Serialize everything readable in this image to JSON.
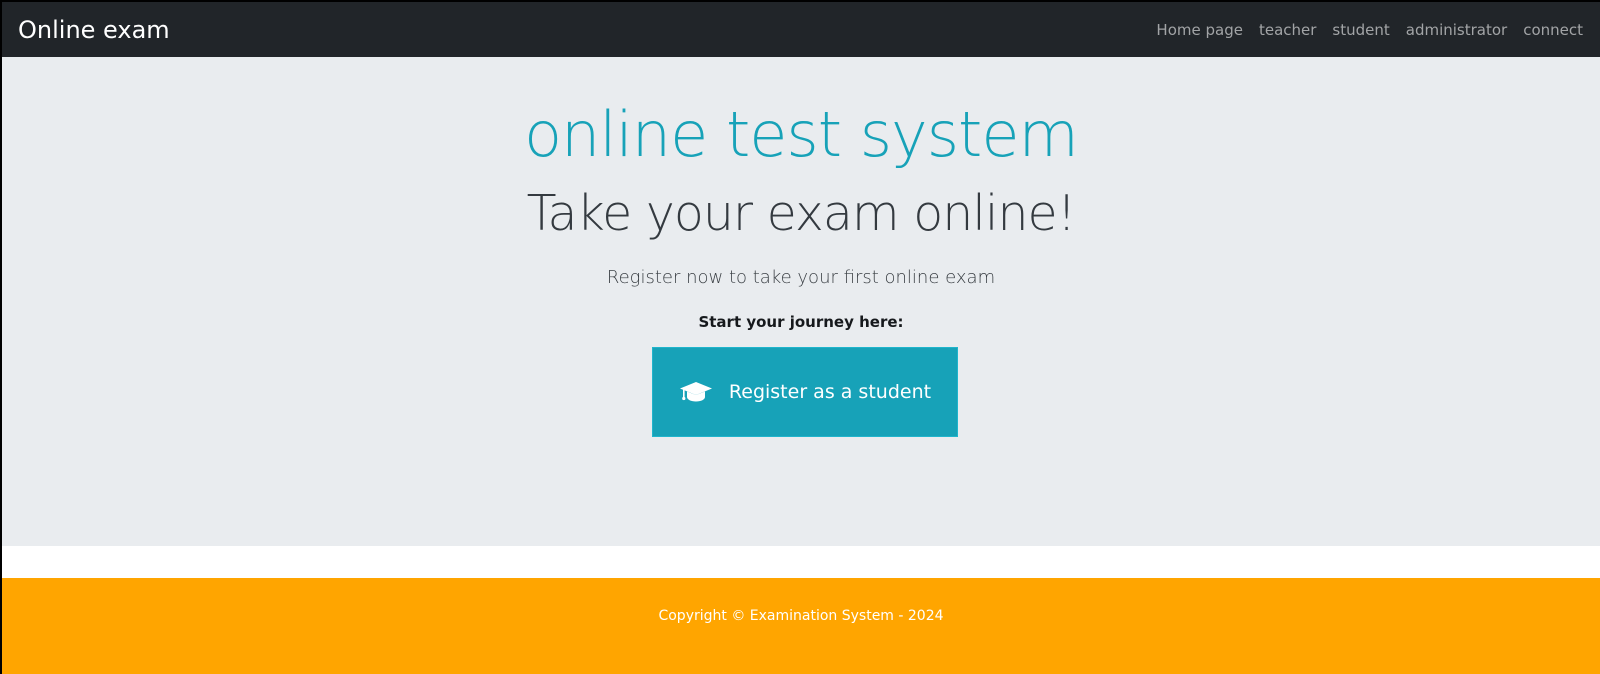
{
  "navbar": {
    "brand": "Online exam",
    "links": [
      {
        "label": "Home page"
      },
      {
        "label": "teacher"
      },
      {
        "label": "student"
      },
      {
        "label": "administrator"
      },
      {
        "label": "connect"
      }
    ]
  },
  "hero": {
    "title": "online test system",
    "subtitle": "Take your exam online!",
    "lead": "Register now to take your first online exam",
    "cta_label": "Start your journey here:",
    "register_button": {
      "label": "Register as a student",
      "icon": "graduation-cap-icon"
    }
  },
  "footer": {
    "copyright": "Copyright © Examination System - 2024"
  },
  "colors": {
    "navbar_bg": "#212529",
    "hero_bg": "#e9ecef",
    "accent": "#17a2b8",
    "footer_bg": "#ffa500"
  }
}
